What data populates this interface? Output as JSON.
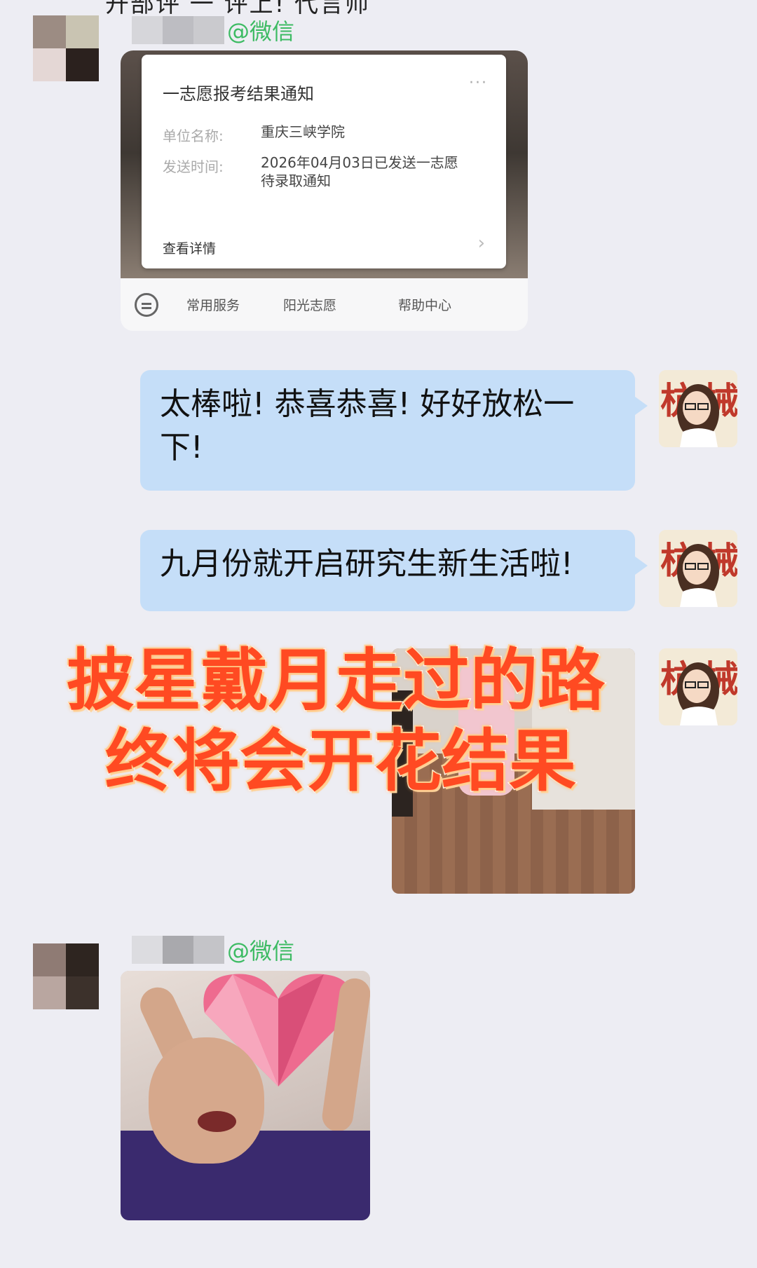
{
  "top_cutoff_text": "开部评   一 评上! 代言师",
  "messages": [
    {
      "sender_tag": "@微信",
      "card": {
        "title": "一志愿报考结果通知",
        "more": "···",
        "unit_label": "单位名称:",
        "unit_value": "重庆三峡学院",
        "time_label": "发送时间:",
        "time_value_1": "2026年04月03日已发送一志愿",
        "time_value_2": "待录取通知",
        "details_link": "查看详情",
        "chevron": "›",
        "bar_items": [
          "常用服务",
          "阳光志愿",
          "帮助中心"
        ],
        "bar_icon": "menu-icon"
      }
    },
    {
      "text_line1": "太棒啦! 恭喜恭喜! 好好放松一",
      "text_line2": "下!"
    },
    {
      "text": "九月份就开启研究生新生活啦!"
    },
    {
      "sender_tag": "@微信"
    }
  ],
  "banner": {
    "line1": "披星戴月走过的路",
    "line2": "终将会开花结果"
  },
  "self_avatar": {
    "glyph": "械"
  },
  "colors": {
    "background": "#ededf3",
    "bubble": "#c5def8",
    "wechat_green": "#3dbb63",
    "banner_red": "#ff4a22"
  }
}
